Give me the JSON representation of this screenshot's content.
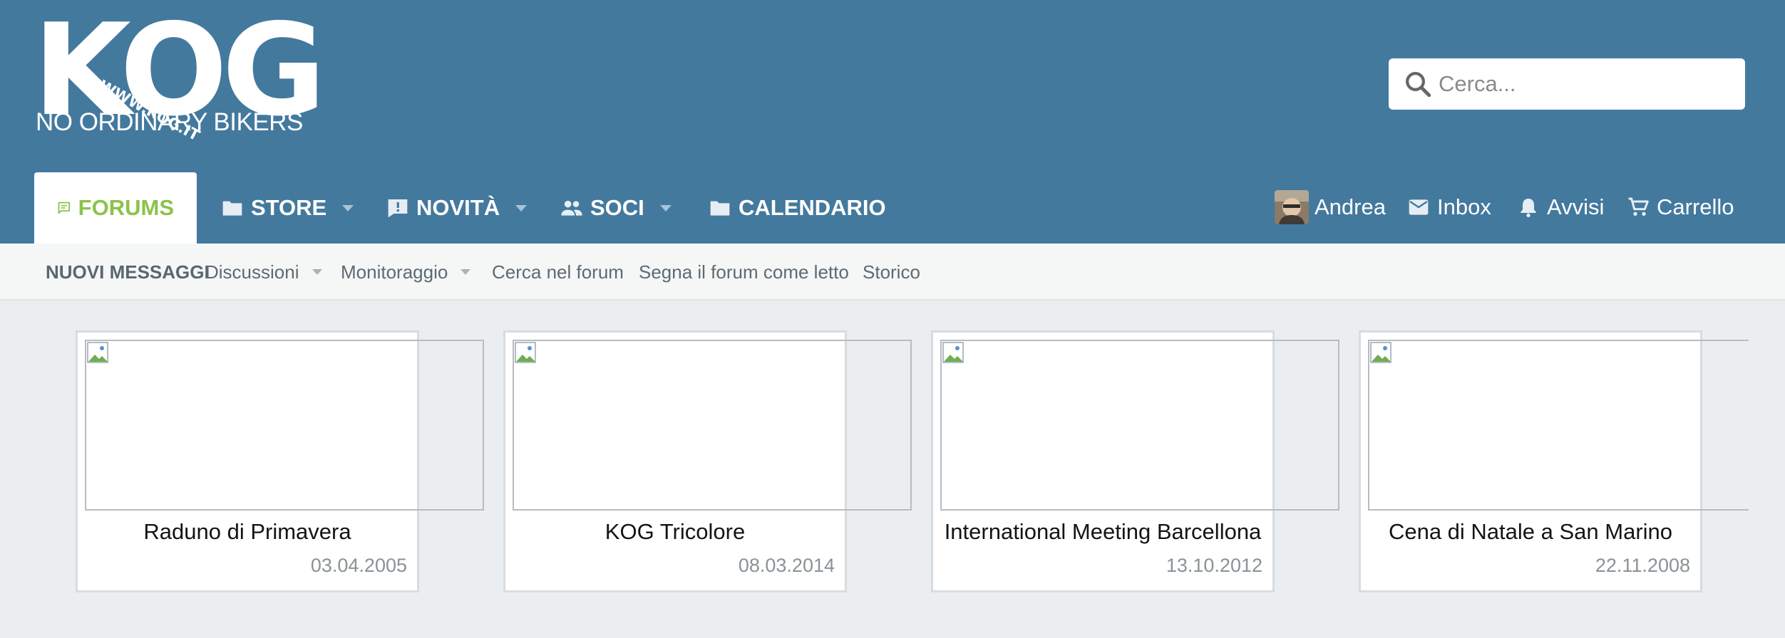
{
  "brand": {
    "logo_text": "KOG",
    "logo_url_text": "WWW.KOG.IT",
    "tagline": "NO ORDINARY BIKERS"
  },
  "search": {
    "placeholder": "Cerca..."
  },
  "main_nav": [
    {
      "label": "FORUMS",
      "icon": "forum-chat-icon",
      "active": true
    },
    {
      "label": "STORE",
      "icon": "folder-icon",
      "has_dropdown": true
    },
    {
      "label": "NOVITÀ",
      "icon": "news-alert-icon",
      "has_dropdown": true
    },
    {
      "label": "SOCI",
      "icon": "people-icon",
      "has_dropdown": true
    },
    {
      "label": "CALENDARIO",
      "icon": "folder-icon"
    }
  ],
  "user_nav": {
    "user": {
      "label": "Andrea",
      "icon": "avatar"
    },
    "inbox": {
      "label": "Inbox",
      "icon": "envelope-icon"
    },
    "alerts": {
      "label": "Avvisi",
      "icon": "bell-icon"
    },
    "cart": {
      "label": "Carrello",
      "icon": "cart-icon"
    }
  },
  "sub_nav": [
    {
      "label": "NUOVI MESSAGGI"
    },
    {
      "label": "Discussioni",
      "has_dropdown": true
    },
    {
      "label": "Monitoraggio",
      "has_dropdown": true
    },
    {
      "label": "Cerca nel forum"
    },
    {
      "label": "Segna il forum come letto"
    },
    {
      "label": "Storico"
    }
  ],
  "events": [
    {
      "title": "Raduno di Primavera",
      "date": "03.04.2005"
    },
    {
      "title": "KOG Tricolore",
      "date": "08.03.2014"
    },
    {
      "title": "International Meeting Barcellona",
      "date": "13.10.2012"
    },
    {
      "title": "Cena di Natale a San Marino",
      "date": "22.11.2008"
    }
  ],
  "colors": {
    "header_bg": "#44799e",
    "active_tab_text": "#8bc34a",
    "page_bg": "#ebeef1",
    "subnav_bg": "#f5f7f7"
  }
}
